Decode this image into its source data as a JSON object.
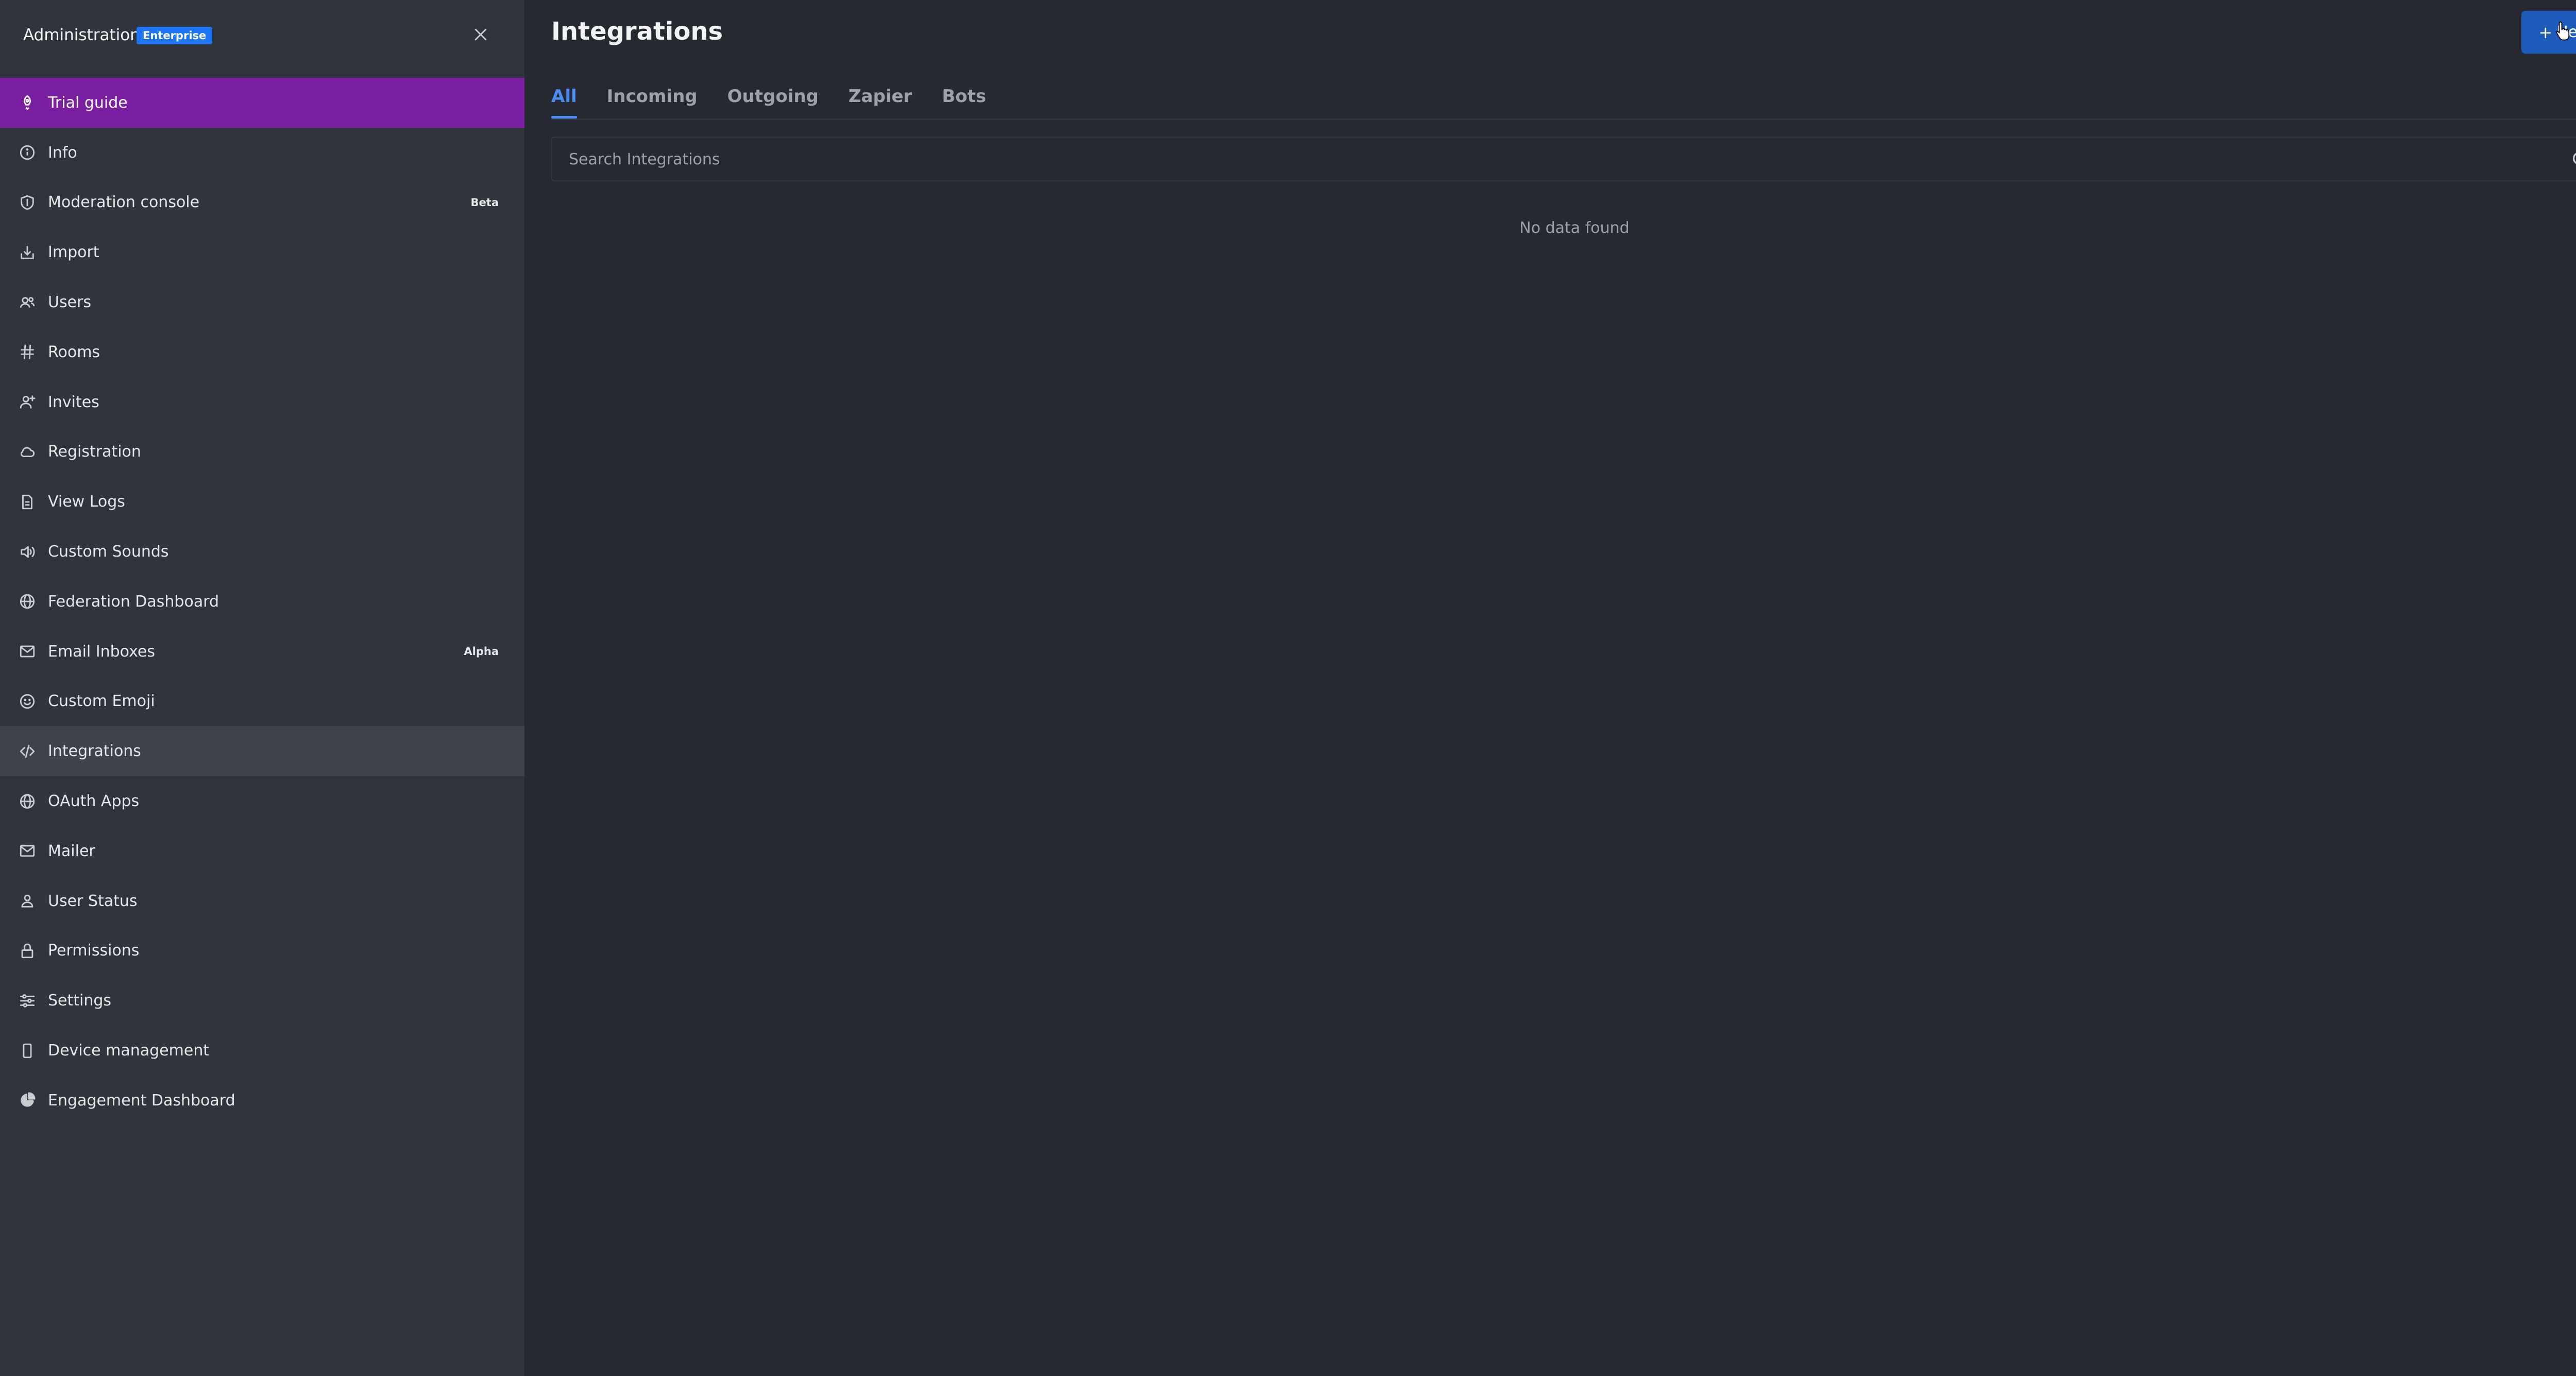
{
  "sidebar": {
    "title": "Administration",
    "badge": "Enterprise",
    "items": [
      {
        "label": "Trial guide",
        "icon": "rocket-icon"
      },
      {
        "label": "Info",
        "icon": "info-icon"
      },
      {
        "label": "Moderation console",
        "icon": "shield-icon",
        "tag": "Beta"
      },
      {
        "label": "Import",
        "icon": "import-icon"
      },
      {
        "label": "Users",
        "icon": "users-icon"
      },
      {
        "label": "Rooms",
        "icon": "hashtag-icon"
      },
      {
        "label": "Invites",
        "icon": "user-plus-icon"
      },
      {
        "label": "Registration",
        "icon": "cloud-icon"
      },
      {
        "label": "View Logs",
        "icon": "file-icon"
      },
      {
        "label": "Custom Sounds",
        "icon": "sound-icon"
      },
      {
        "label": "Federation Dashboard",
        "icon": "globe-icon"
      },
      {
        "label": "Email Inboxes",
        "icon": "mail-icon",
        "tag": "Alpha"
      },
      {
        "label": "Custom Emoji",
        "icon": "emoji-icon"
      },
      {
        "label": "Integrations",
        "icon": "code-icon"
      },
      {
        "label": "OAuth Apps",
        "icon": "globe-icon"
      },
      {
        "label": "Mailer",
        "icon": "mail-icon"
      },
      {
        "label": "User Status",
        "icon": "user-icon"
      },
      {
        "label": "Permissions",
        "icon": "lock-icon"
      },
      {
        "label": "Settings",
        "icon": "sliders-icon"
      },
      {
        "label": "Device management",
        "icon": "mobile-icon"
      },
      {
        "label": "Engagement Dashboard",
        "icon": "pie-chart-icon"
      }
    ]
  },
  "header": {
    "title": "Integrations",
    "new_label": "New"
  },
  "tabs": [
    {
      "label": "All"
    },
    {
      "label": "Incoming"
    },
    {
      "label": "Outgoing"
    },
    {
      "label": "Zapier"
    },
    {
      "label": "Bots"
    }
  ],
  "search": {
    "placeholder": "Search Integrations",
    "value": ""
  },
  "empty_state": "No data found",
  "colors": {
    "highlight": "#7b1fa2",
    "accent": "#1d74f5",
    "sidebar_bg": "#2f343d",
    "main_bg": "#262932"
  }
}
